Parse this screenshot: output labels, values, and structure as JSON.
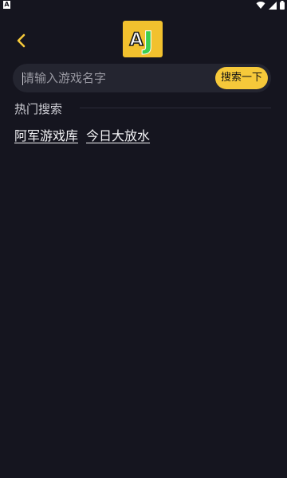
{
  "status_bar": {
    "left_badge": "A"
  },
  "header": {
    "logo_text_a": "A",
    "logo_text_j": "J"
  },
  "search": {
    "placeholder": "请输入游戏名字",
    "value": "",
    "button_label": "搜索一下"
  },
  "hot_search": {
    "title": "热门搜索",
    "items": [
      {
        "label": "阿军游戏库"
      },
      {
        "label": "今日大放水"
      }
    ]
  },
  "colors": {
    "background": "#15151f",
    "accent": "#f6c93a",
    "search_bg": "#242530"
  },
  "icons": [
    "back-chevron-icon",
    "wifi-icon",
    "signal-icon",
    "battery-icon"
  ]
}
